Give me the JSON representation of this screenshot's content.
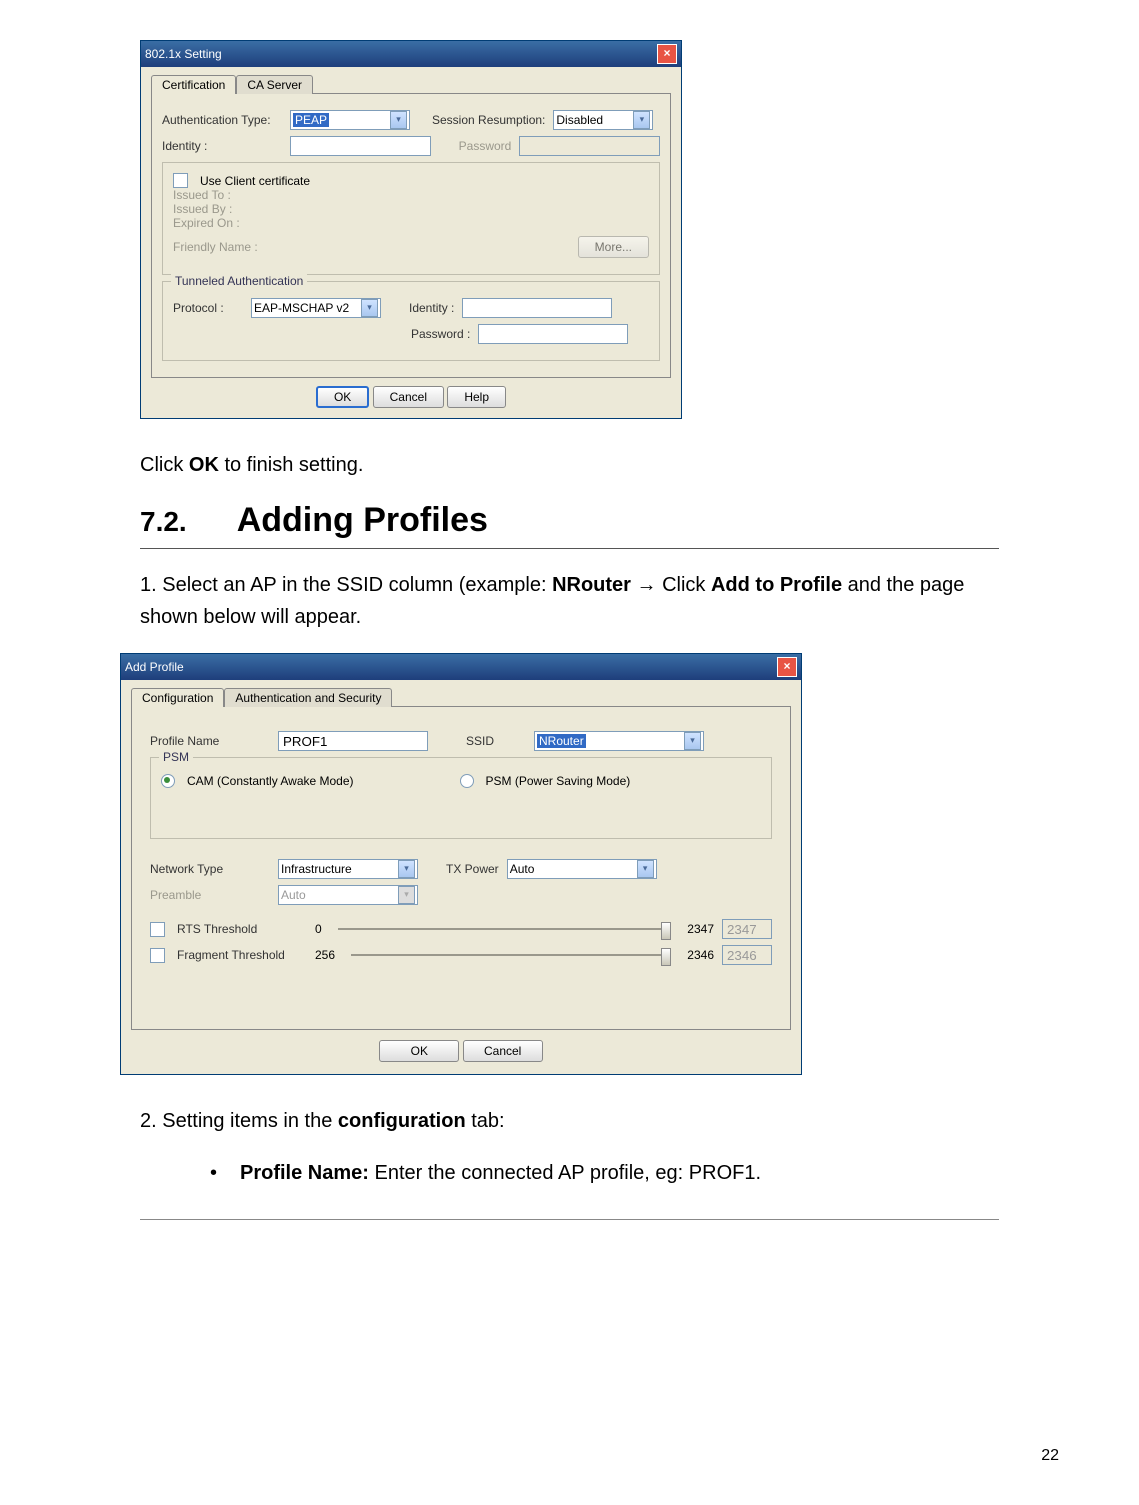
{
  "page_number": "22",
  "dlg1": {
    "title": "802.1x Setting",
    "tabs": [
      "Certification",
      "CA Server"
    ],
    "auth_type_label": "Authentication Type:",
    "auth_type_value": "PEAP",
    "session_label": "Session Resumption:",
    "session_value": "Disabled",
    "identity_label": "Identity :",
    "password_label": "Password",
    "use_cert_label": "Use Client certificate",
    "issued_to": "Issued To :",
    "issued_by": "Issued By :",
    "expired_on": "Expired On :",
    "friendly": "Friendly Name :",
    "more_btn": "More...",
    "tunneled_legend": "Tunneled Authentication",
    "protocol_label": "Protocol :",
    "protocol_value": "EAP-MSCHAP v2",
    "t_identity_label": "Identity :",
    "t_password_label": "Password :",
    "ok": "OK",
    "cancel": "Cancel",
    "help": "Help"
  },
  "text1_a": "Click ",
  "text1_b": "OK",
  "text1_c": " to finish setting.",
  "heading_num": "7.2.",
  "heading_txt": "Adding Profiles",
  "step1_a": "1. Select an AP in the SSID column (example: ",
  "step1_b": "NRouter",
  "step1_c": " → Click ",
  "step1_d": "Add to Profile",
  "step1_e": " and the page shown below will appear.",
  "dlg2": {
    "title": "Add Profile",
    "tabs": [
      "Configuration",
      "Authentication and Security"
    ],
    "profile_name_label": "Profile Name",
    "profile_name_value": "PROF1",
    "ssid_label": "SSID",
    "ssid_value": "NRouter",
    "psm_legend": "PSM",
    "cam_label": "CAM (Constantly Awake Mode)",
    "psm_label": "PSM (Power Saving Mode)",
    "network_type_label": "Network Type",
    "network_type_value": "Infrastructure",
    "tx_power_label": "TX Power",
    "tx_power_value": "Auto",
    "preamble_label": "Preamble",
    "preamble_value": "Auto",
    "rts_label": "RTS Threshold",
    "rts_min": "0",
    "rts_max": "2347",
    "rts_value": "2347",
    "frag_label": "Fragment Threshold",
    "frag_min": "256",
    "frag_max": "2346",
    "frag_value": "2346",
    "ok": "OK",
    "cancel": "Cancel"
  },
  "step2_a": "2. Setting items in the ",
  "step2_b": "configuration",
  "step2_c": " tab:",
  "bullet1_a": "Profile Name:",
  "bullet1_b": " Enter the connected AP profile, eg: PROF1."
}
